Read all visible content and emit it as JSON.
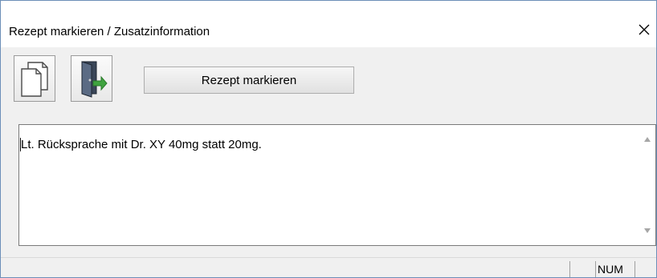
{
  "window": {
    "title": "Rezept markieren / Zusatzinformation",
    "close_icon": "close-icon"
  },
  "toolbar": {
    "new_icon": "new-document-icon",
    "exit_icon": "exit-door-icon",
    "mark_label": "Rezept markieren"
  },
  "note": {
    "text": "Lt. Rücksprache mit Dr. XY 40mg statt 20mg."
  },
  "statusbar": {
    "num_label": "NUM"
  },
  "colors": {
    "window_border": "#6c8fb8",
    "background": "#f0f0f0",
    "door_green": "#3fa33f",
    "door_dark": "#2f3a4a"
  }
}
